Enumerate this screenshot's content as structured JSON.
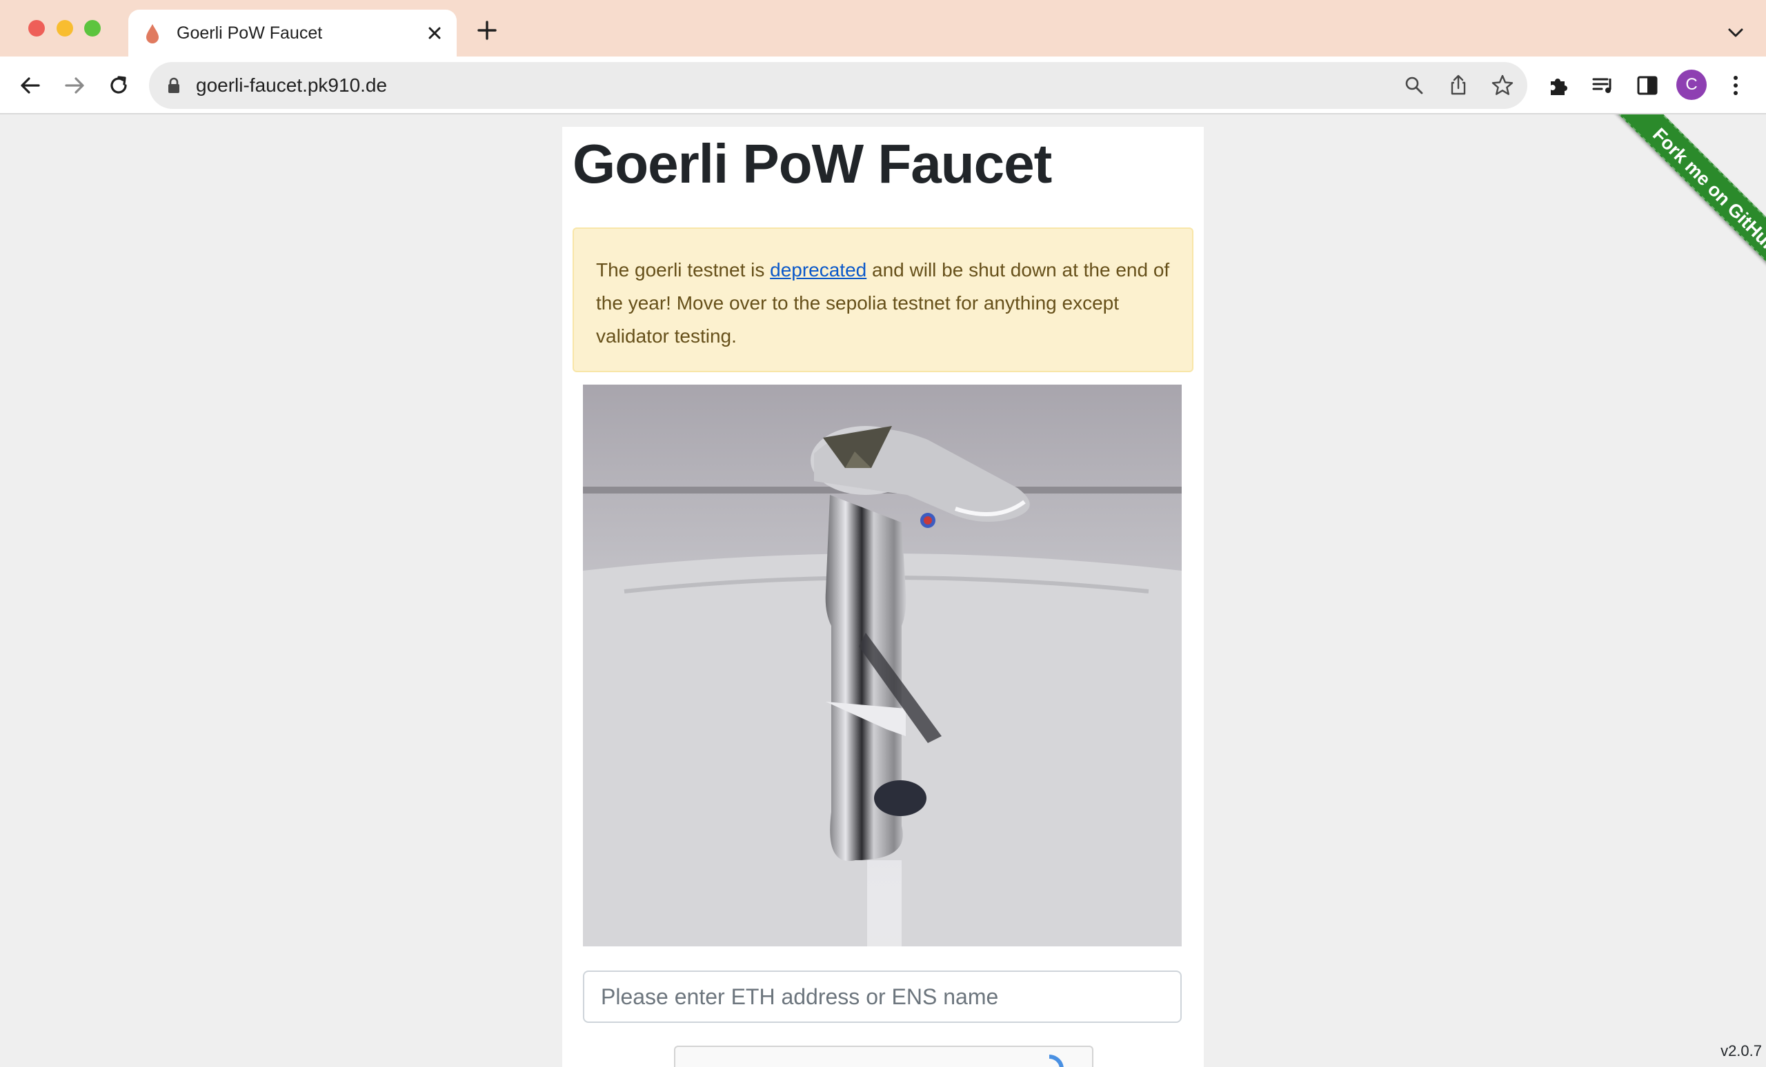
{
  "browser": {
    "tab_title": "Goerli PoW Faucet",
    "url": "goerli-faucet.pk910.de",
    "profile_initial": "C"
  },
  "page": {
    "title": "Goerli PoW Faucet",
    "alert": {
      "before_link": "The goerli testnet is ",
      "link_text": "deprecated",
      "after_link": " and will be shut down at the end of the year! Move over to the sepolia testnet for anything except validator testing."
    },
    "address_placeholder": "Please enter ETH address or ENS name",
    "ribbon_text": "Fork me on GitHub",
    "version": "v2.0.7"
  },
  "colors": {
    "tabstrip": "#f7dccd",
    "alert_bg": "#fcf1cf",
    "ribbon": "#2b8a2b",
    "link": "#0a58ca"
  },
  "icons": [
    "back-icon",
    "forward-icon",
    "reload-icon",
    "lock-icon",
    "zoom-icon",
    "share-icon",
    "bookmark-star-icon",
    "extensions-icon",
    "media-control-icon",
    "side-panel-icon",
    "menu-icon",
    "water-drop-icon"
  ]
}
